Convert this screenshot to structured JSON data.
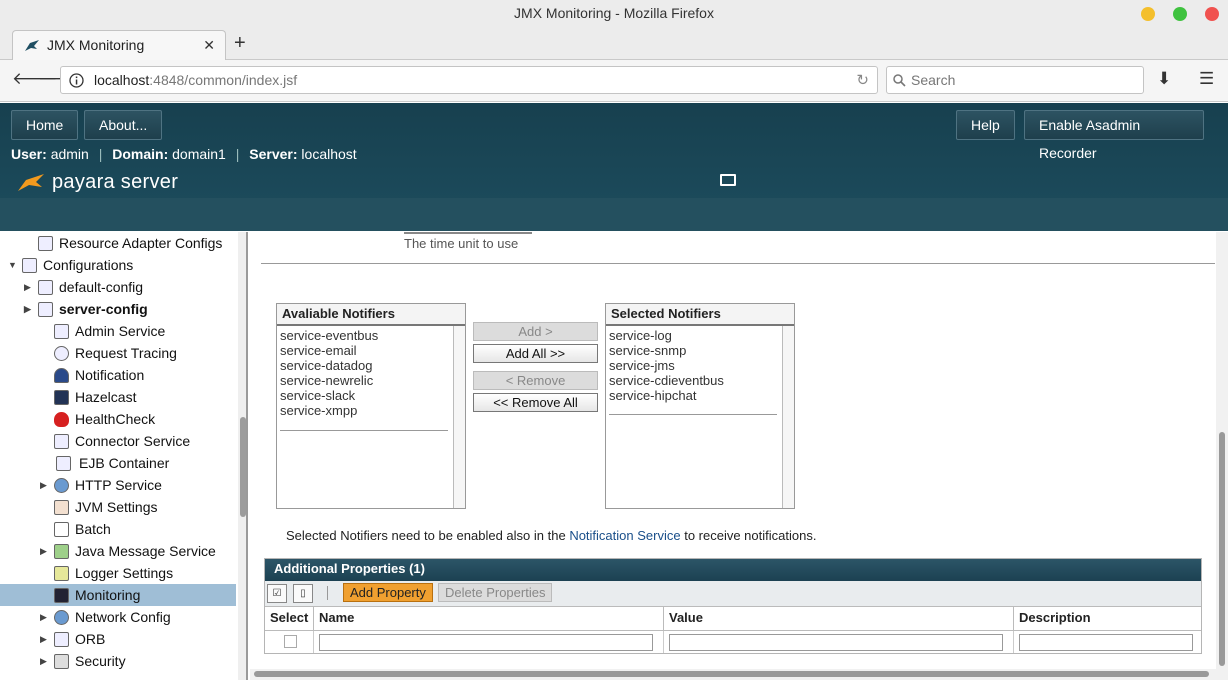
{
  "window": {
    "title": "JMX Monitoring - Mozilla Firefox"
  },
  "browser": {
    "tab_title": "JMX Monitoring",
    "url_host": "localhost",
    "url_rest": ":4848/common/index.jsf",
    "search_placeholder": "Search"
  },
  "header": {
    "home_label": "Home",
    "about_label": "About...",
    "help_label": "Help",
    "recorder_label": "Enable Asadmin Recorder",
    "user_key": "User:",
    "user_val": "admin",
    "domain_key": "Domain:",
    "domain_val": "domain1",
    "server_key": "Server:",
    "server_val": "localhost",
    "logo_text": "payara server"
  },
  "sidebar": {
    "items": [
      {
        "label": "Resource Adapter Configs",
        "expand": ""
      },
      {
        "label": "Configurations",
        "expand": "▼"
      },
      {
        "label": "default-config",
        "expand": "▶"
      },
      {
        "label": "server-config",
        "expand": "▶"
      },
      {
        "label": "Admin Service",
        "expand": ""
      },
      {
        "label": "Request Tracing",
        "expand": ""
      },
      {
        "label": "Notification",
        "expand": ""
      },
      {
        "label": "Hazelcast",
        "expand": ""
      },
      {
        "label": "HealthCheck",
        "expand": ""
      },
      {
        "label": "Connector Service",
        "expand": ""
      },
      {
        "label": "EJB Container",
        "expand": ""
      },
      {
        "label": "HTTP Service",
        "expand": "▶"
      },
      {
        "label": "JVM Settings",
        "expand": ""
      },
      {
        "label": "Batch",
        "expand": ""
      },
      {
        "label": "Java Message Service",
        "expand": "▶"
      },
      {
        "label": "Logger Settings",
        "expand": ""
      },
      {
        "label": "Monitoring",
        "expand": ""
      },
      {
        "label": "Network Config",
        "expand": "▶"
      },
      {
        "label": "ORB",
        "expand": "▶"
      },
      {
        "label": "Security",
        "expand": "▶"
      }
    ]
  },
  "main": {
    "time_unit_hint": "The time unit to use",
    "available_title": "Avaliable Notifiers",
    "available_items": [
      "service-eventbus",
      "service-email",
      "service-datadog",
      "service-newrelic",
      "service-slack",
      "service-xmpp"
    ],
    "selected_title": "Selected Notifiers",
    "selected_items": [
      "service-log",
      "service-snmp",
      "service-jms",
      "service-cdieventbus",
      "service-hipchat"
    ],
    "add_label": "Add >",
    "add_all_label": "Add All >>",
    "remove_label": "< Remove",
    "remove_all_label": "<< Remove All",
    "note_before": "Selected Notifiers need to be enabled also in the ",
    "note_link": "Notification Service",
    "note_after": " to receive notifications.",
    "props_title": "Additional Properties (1)",
    "add_property_label": "Add Property",
    "delete_properties_label": "Delete Properties",
    "col_select": "Select",
    "col_name": "Name",
    "col_value": "Value",
    "col_description": "Description"
  }
}
